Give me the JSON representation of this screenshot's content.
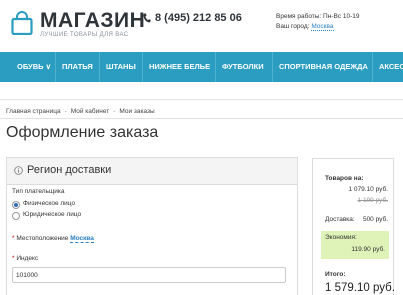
{
  "header": {
    "logo_name": "МАГАЗИН",
    "logo_tagline": "ЛУЧШИЕ ТОВАРЫ ДЛЯ ВАС",
    "phone": "8 (495) 212 85 06",
    "work_hours": "Время работы: Пн-Вс 10-19",
    "region_label": "Ваш город:",
    "region_value": "Москва"
  },
  "nav": {
    "items": [
      "ОБУВЬ ∨",
      "ПЛАТЬЯ",
      "ШТАНЫ",
      "НИЖНЕЕ БЕЛЬЕ",
      "ФУТБОЛКИ",
      "СПОРТИВНАЯ ОДЕЖДА",
      "АКСЕС"
    ]
  },
  "breadcrumb": [
    "Главная страница",
    "Мой кабинет",
    "Мои заказы"
  ],
  "page_title": "Оформление заказа",
  "delivery_panel": {
    "title": "Регион доставки",
    "payer_type_label": "Тип плательщика",
    "payer_options": [
      "Физическое лицо",
      "Юридическое лицо"
    ],
    "selected_payer": 0,
    "location_label": "Местоположение",
    "location_value": "Москва",
    "index_label": "Индекс",
    "index_value": "101000"
  },
  "summary": {
    "goods_label": "Товаров на:",
    "goods_price": "1 079.10 руб.",
    "goods_old_price": "1 199 руб.",
    "delivery_label": "Доставка:",
    "delivery_price": "500 руб.",
    "economy_label": "Экономия:",
    "economy_value": "119.90 руб.",
    "total_label": "Итого:",
    "total_value": "1 579.10 руб."
  },
  "colors": {
    "nav_bg": "#2a9dc0",
    "link": "#2a82c5",
    "economy_bg": "#dff2b8"
  }
}
